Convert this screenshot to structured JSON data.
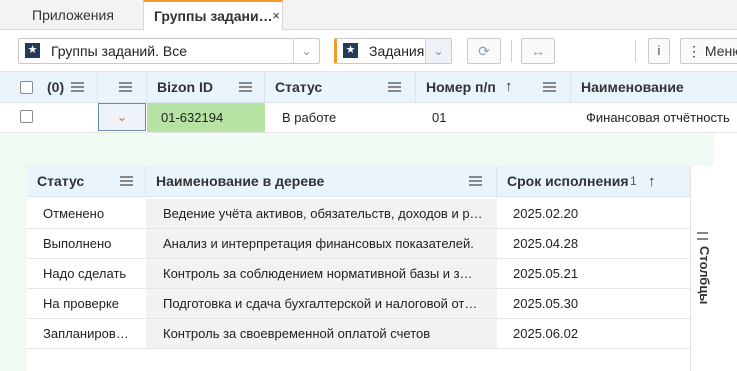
{
  "tabs": {
    "apps_label": "Приложения",
    "groups_label": "Группы задани…",
    "close_glyph": "×"
  },
  "toolbar": {
    "view_select": {
      "value": "Группы заданий. Все",
      "icon": "star-icon"
    },
    "tasks_select": {
      "value": "Задания",
      "icon": "star-icon"
    },
    "refresh_icon": "refresh-icon",
    "expand_icon": "expand-horizontal-icon",
    "info_label": "i",
    "menu_label": "Меню"
  },
  "grid": {
    "columns": {
      "selection_count": "(0)",
      "bizon_id": "Bizon ID",
      "status": "Статус",
      "number": "Номер п/п",
      "name": "Наименование"
    },
    "row": {
      "bizon_id": "01-632194",
      "status": "В работе",
      "number": "01",
      "name": "Финансовая отчётность"
    }
  },
  "subgrid": {
    "columns": {
      "status": "Статус",
      "tree_name": "Наименование в дереве",
      "deadline": "Срок исполнения",
      "sort_index": "1"
    },
    "rows": [
      {
        "status": "Отменено",
        "name": "Ведение учёта активов, обязательств, доходов и р…",
        "deadline": "2025.02.20"
      },
      {
        "status": "Выполнено",
        "name": "Анализ и интерпретация финансовых показателей.",
        "deadline": "2025.04.28"
      },
      {
        "status": "Надо сделать",
        "name": "Контроль за соблюдением нормативной базы и з…",
        "deadline": "2025.05.21"
      },
      {
        "status": "На проверке",
        "name": "Подготовка и сдача бухгалтерской и налоговой от…",
        "deadline": "2025.05.30"
      },
      {
        "status": "Запланиров…",
        "name": "Контроль за своевременной оплатой счетов",
        "deadline": "2025.06.02"
      }
    ],
    "side_panel_label": "Столбцы"
  },
  "colors": {
    "accent_orange": "#f39a2b",
    "header_blue": "#eaf4fc",
    "bizon_green": "#b6e3a3",
    "detail_bg": "#eefaf2"
  }
}
